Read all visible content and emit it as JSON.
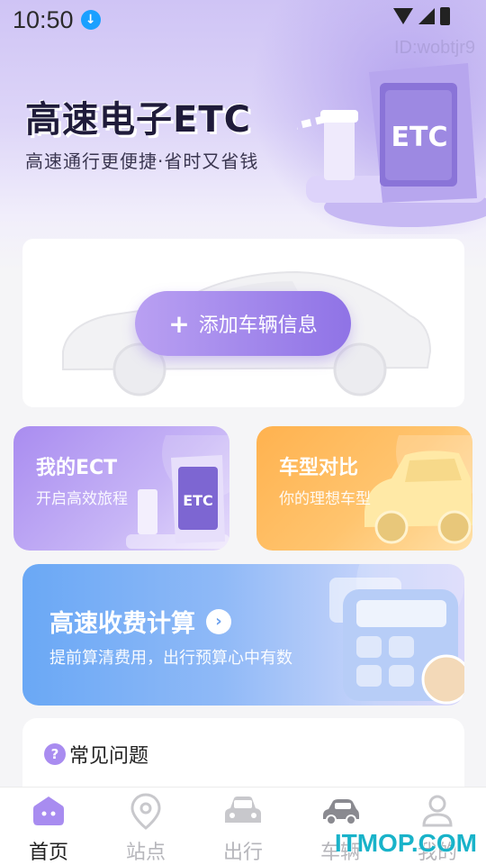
{
  "status_bar": {
    "time": "10:50",
    "download_icon": "download-icon",
    "wifi_icon": "wifi-icon",
    "cell_icon": "cellular-signal-icon",
    "battery_icon": "battery-icon"
  },
  "watermark_id": "ID:wobtjr9",
  "hero": {
    "title": "高速电子ETC",
    "subtitle": "高速通行更便捷·省时又省钱",
    "gate_label": "ETC"
  },
  "vehicle_card": {
    "add_button_label": "添加车辆信息",
    "add_icon": "plus-icon"
  },
  "tiles": [
    {
      "title": "我的ECT",
      "subtitle": "开启高效旅程",
      "art_label": "ETC"
    },
    {
      "title": "车型对比",
      "subtitle": "你的理想车型"
    }
  ],
  "toll_calc": {
    "title": "高速收费计算",
    "subtitle": "提前算清费用，出行预算心中有数",
    "arrow_icon": "chevron-right-icon"
  },
  "faq": {
    "icon_text": "?",
    "title": "常见问题"
  },
  "tabbar": {
    "items": [
      {
        "label": "首页",
        "icon": "home-icon",
        "active": true
      },
      {
        "label": "站点",
        "icon": "location-pin-icon",
        "active": false
      },
      {
        "label": "出行",
        "icon": "car-front-icon",
        "active": false
      },
      {
        "label": "车辆",
        "icon": "car-side-icon",
        "active": false
      },
      {
        "label": "我的",
        "icon": "user-icon",
        "active": false
      }
    ]
  },
  "brand_watermark": "ITMOP.COM",
  "colors": {
    "accent_purple": "#8f73e6",
    "orange": "#ffb24f",
    "blue": "#6aa8f5",
    "watermark_teal": "#19b3c9"
  }
}
